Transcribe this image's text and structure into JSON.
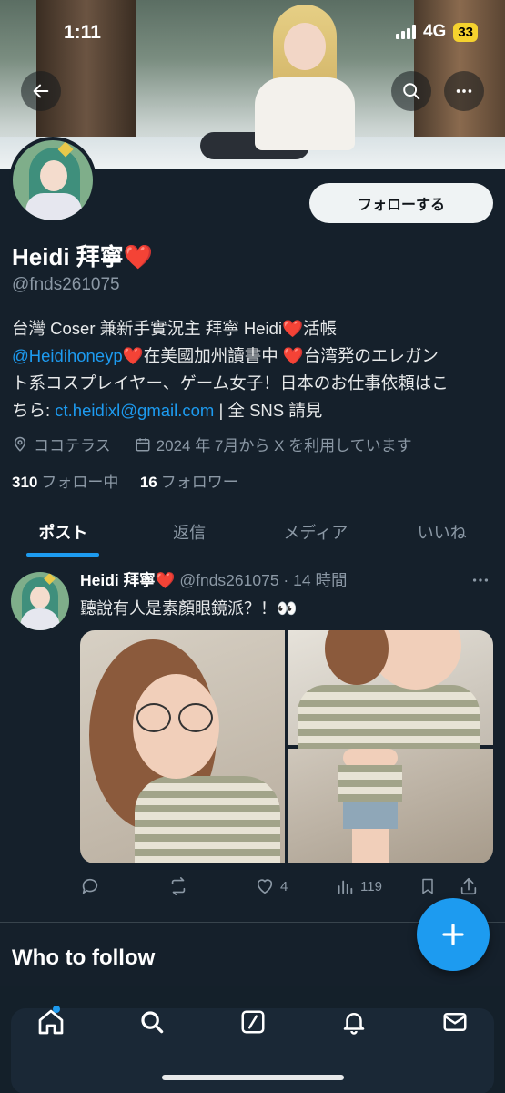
{
  "status_bar": {
    "time": "1:11",
    "network": "4G",
    "battery": "33"
  },
  "profile": {
    "follow_button": "フォローする",
    "display_name": "Heidi 拜寧",
    "heart": "❤️",
    "handle": "@fnds261075",
    "bio": {
      "line1": "台灣 Coser 兼新手實況主 拜寧 Heidi",
      "line1_suffix": "活帳",
      "mention": "@Heidihoneyp",
      "line2_text": "在美國加州讀書中 ",
      "line2_tail": "台湾発のエレガン",
      "line3": "ト系コスプレイヤー、ゲーム女子！日本のお仕事依頼はこ",
      "line4_prefix": "ちら: ",
      "email": "ct.heidixl@gmail.com",
      "line4_suffix": " | 全 SNS 請見"
    },
    "location": "ココテラス",
    "joined": "2024 年 7月から X を利用しています",
    "following_count": "310",
    "following_label": "フォロー中",
    "followers_count": "16",
    "followers_label": "フォロワー"
  },
  "tabs": [
    {
      "label": "ポスト",
      "active": true
    },
    {
      "label": "返信",
      "active": false
    },
    {
      "label": "メディア",
      "active": false
    },
    {
      "label": "いいね",
      "active": false
    }
  ],
  "post": {
    "author_name": "Heidi 拜寧",
    "heart": "❤️",
    "handle_time": "@fnds261075 · 14 時間",
    "text": "聽說有人是素顏眼鏡派？！👀",
    "likes": "4",
    "views": "119"
  },
  "who_to_follow": {
    "title": "Who to follow"
  },
  "icons": {
    "back": "arrow-left-icon",
    "search": "search-icon",
    "more": "more-horizontal-icon",
    "location": "location-pin-icon",
    "calendar": "calendar-icon"
  },
  "colors": {
    "background": "#15202b",
    "accent": "#1d9bf0",
    "heart": "#f0263c",
    "muted": "#8b98a5"
  }
}
